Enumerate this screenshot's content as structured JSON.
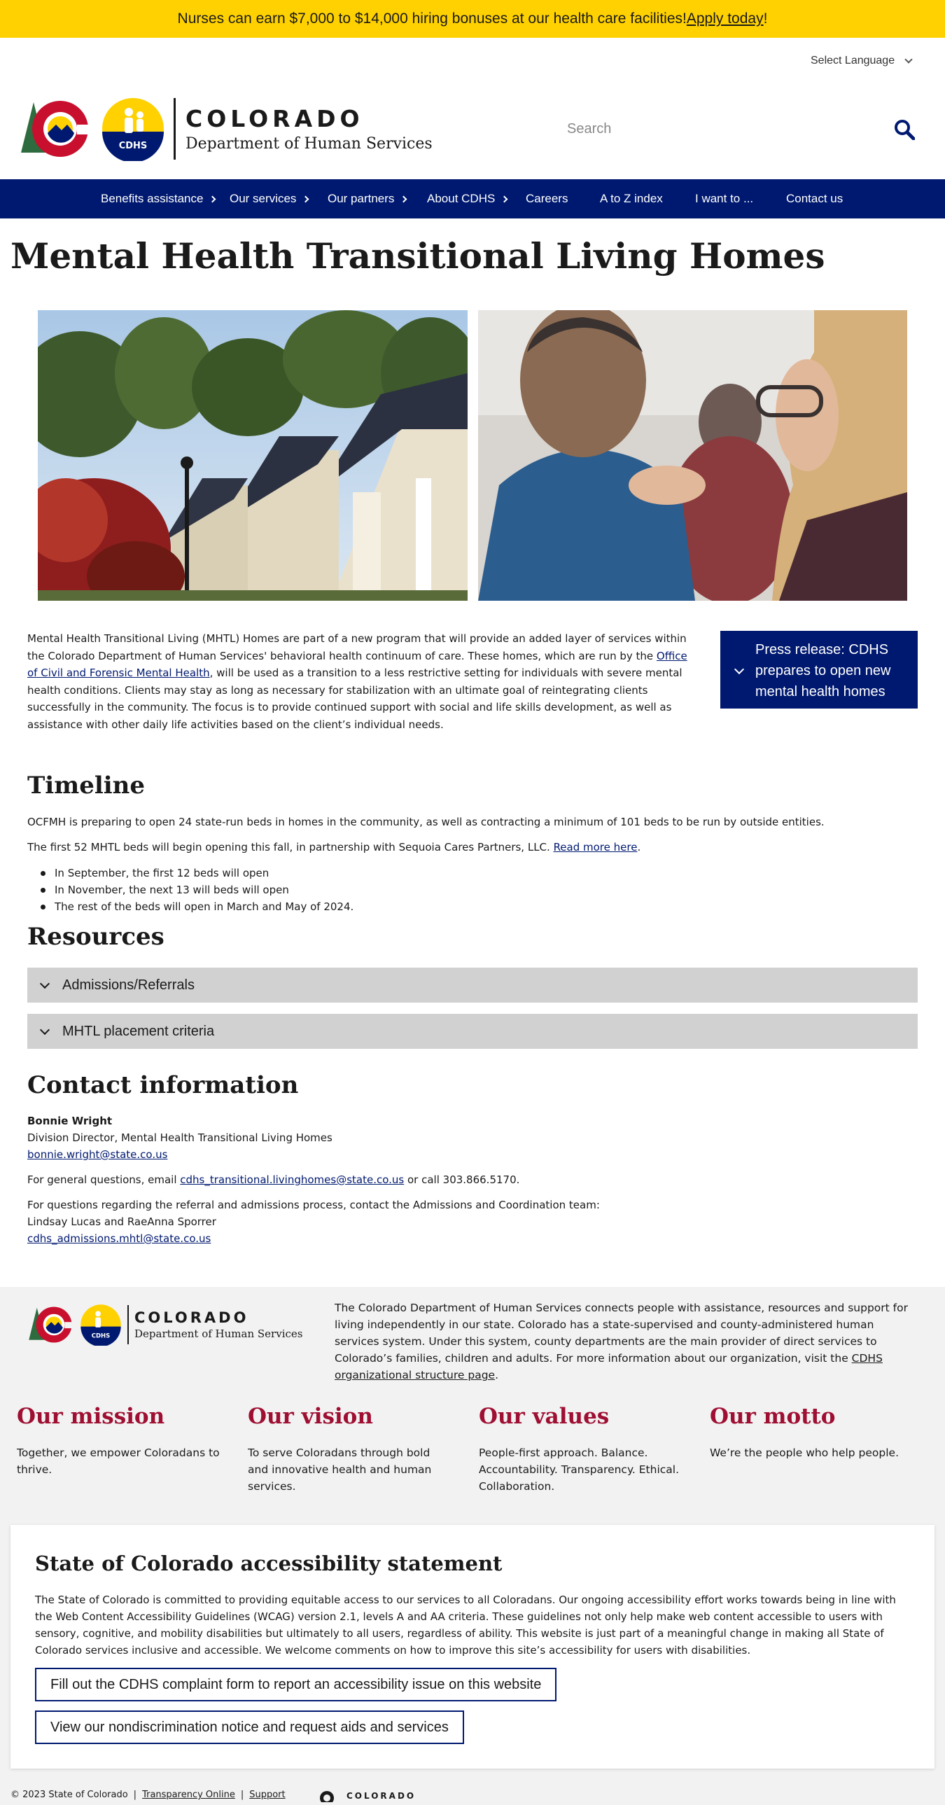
{
  "banner": {
    "text": "Nurses can earn $7,000 to $14,000 hiring bonuses at our health care facilities! ",
    "link": "Apply today",
    "suffix": "!"
  },
  "language": {
    "label": "Select Language"
  },
  "header": {
    "state": "COLORADO",
    "dept": "Department of Human Services",
    "cdhs_badge": "CDHS",
    "search_placeholder": "Search"
  },
  "nav": {
    "items": [
      {
        "label": "Benefits assistance",
        "caret": true
      },
      {
        "label": "Our services",
        "caret": true
      },
      {
        "label": "Our partners",
        "caret": true
      },
      {
        "label": "About CDHS",
        "caret": true
      },
      {
        "label": "Careers",
        "caret": false
      },
      {
        "label": "A to Z index",
        "caret": false
      },
      {
        "label": "I want to ...",
        "caret": false
      },
      {
        "label": "Contact us",
        "caret": false
      }
    ]
  },
  "page": {
    "title": "Mental Health Transitional Living Homes",
    "intro_1": "Mental Health Transitional Living (MHTL) Homes are part of a new program that will provide an added layer of services within the Colorado Department of Human Services' behavioral health continuum of care. These homes, which are run by the ",
    "intro_link": "Office of Civil and Forensic Mental Health",
    "intro_2": ", will be used as a transition to a less restrictive setting for individuals with severe mental health conditions. Clients may stay as long as necessary for stabilization with an ultimate goal of reintegrating clients successfully in the community. The focus is to provide continued support with social and life skills development, as well as assistance with other daily life activities based on the client’s individual needs.",
    "press_release": "Press release: CDHS prepares to open new mental health homes"
  },
  "timeline": {
    "heading": "Timeline",
    "p1": "OCFMH is preparing to open 24 state-run beds in homes in the community, as well as contracting a minimum of 101 beds to be run by outside entities.",
    "p2": "The first 52 MHTL beds will begin opening this fall, in partnership with Sequoia Cares Partners, LLC. ",
    "p2_link": "Read more here",
    "p2_end": ".",
    "bullets": [
      "In September, the first 12 beds will open",
      "In November, the next 13 will beds will open",
      "The rest of the beds will open in March and May of 2024."
    ]
  },
  "resources": {
    "heading": "Resources",
    "accordions": [
      "Admissions/Referrals",
      "MHTL placement criteria"
    ]
  },
  "contact": {
    "heading": "Contact information",
    "name": "Bonnie Wright",
    "role": "Division Director, Mental Health Transitional Living Homes",
    "email": "bonnie.wright@state.co.us",
    "general_prefix": "For general questions, email ",
    "general_email": "cdhs_transitional.livinghomes@state.co.us",
    "general_suffix": " or call 303.866.5170.",
    "referral_text": "For questions regarding the referral and admissions process, contact the Admissions and Coordination team:",
    "team": "Lindsay Lucas and RaeAnna Sporrer",
    "team_email": "cdhs_admissions.mhtl@state.co.us"
  },
  "footer": {
    "about": "The Colorado Department of Human Services connects people with assistance, resources and support for living independently in our state. Colorado has a state-supervised and county-administered human services system. Under this system, county departments are the main provider of direct services to Colorado’s families, children and adults. For more information about our organization, visit the ",
    "about_link": "CDHS organizational structure page",
    "about_end": ".",
    "mission": {
      "title": "Our mission",
      "text": "Together, we empower Coloradans to thrive."
    },
    "vision": {
      "title": "Our vision",
      "text": "To serve Coloradans through bold and innovative health and human services."
    },
    "values": {
      "title": "Our values",
      "text": "People-first approach. Balance. Accountability. Transparency. Ethical. Collaboration."
    },
    "motto": {
      "title": "Our motto",
      "text": "We’re the people who help people."
    },
    "a11y": {
      "title": "State of Colorado accessibility statement",
      "text": "The State of Colorado is committed to providing equitable access to our services to all Coloradans. Our ongoing accessibility effort works towards being in line with the Web Content Accessibility Guidelines (WCAG) version 2.1, levels A and AA criteria. These guidelines not only help make web content accessible to users with sensory, cognitive, and mobility disabilities but ultimately to all users, regardless of ability. This website is just part of a meaningful change in making all State of Colorado services inclusive and accessible. We welcome comments on how to improve this site’s accessibility for users with disabilities.",
      "btn1": "Fill out the CDHS complaint form to report an accessibility issue on this website",
      "btn2": "View our nondiscrimination notice and request aids and services"
    },
    "copyright": "© 2023 State of Colorado",
    "sep": "|",
    "transparency": "Transparency Online",
    "support": "Support",
    "bottom_logo": "COLORADO"
  },
  "colors": {
    "banner": "#ffd100",
    "nav": "#001970",
    "accent_red": "#9e0f32",
    "accordion": "#d1d1d1",
    "footer_bg": "#f2f2f2"
  },
  "icons": [
    "chevron-down-icon",
    "search-icon",
    "chevron-right-icon",
    "colorado-logo-icon",
    "cdhs-badge-icon"
  ]
}
